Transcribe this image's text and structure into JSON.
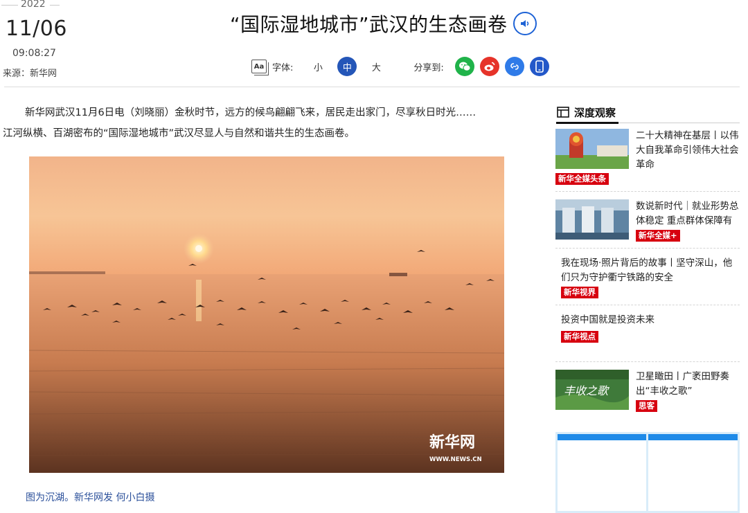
{
  "date": {
    "year": "2022",
    "day": "11/06",
    "time": "09:08:27",
    "source": "来源：新华网"
  },
  "headline": {
    "title": "“国际湿地城市”武汉的生态画卷"
  },
  "tools": {
    "font_label": "字体:",
    "font_options": [
      "小",
      "中",
      "大"
    ],
    "font_selected": "中",
    "share_label": "分享到:",
    "share_icons": [
      "wechat-icon",
      "weibo-icon",
      "link-icon",
      "mobile-icon"
    ]
  },
  "article": {
    "paragraph_line1": "新华网武汉11月6日电（刘晓丽）金秋时节，远方的候鸟翩翩飞来，居民走出家门，尽享秋日时光……",
    "paragraph_line2": "江河纵横、百湖密布的“国际湿地城市”武汉尽显人与自然和谐共生的生态画卷。",
    "photo_watermark": "新华网",
    "photo_watermark_url": "WWW.NEWS.CN",
    "caption": "图为沉湖。新华网发 何小白摄"
  },
  "sidebar": {
    "title": "深度观察",
    "items": [
      {
        "text": "二十大精神在基层丨以伟大自我革命引领伟大社会革命",
        "tag": "新华全媒头条",
        "has_thumb": true
      },
      {
        "text": "数说新时代｜就业形势总体稳定 重点群体保障有力",
        "tag": "新华全媒+",
        "has_thumb": true
      },
      {
        "text": "我在现场·照片背后的故事丨坚守深山，他们只为守护衢宁铁路的安全",
        "tag": "新华视界",
        "has_thumb": false
      },
      {
        "text": "投资中国就是投资未来",
        "tag": "新华视点",
        "has_thumb": false
      },
      {
        "text": "卫星瞰田丨广袤田野奏出“丰收之歌”",
        "tag": "思客",
        "has_thumb": true,
        "thumb_text": "丰收之歌"
      }
    ]
  },
  "colors": {
    "accent_blue": "#2456b8",
    "tag_red": "#d7000f",
    "caption_blue": "#2a4f9a"
  }
}
